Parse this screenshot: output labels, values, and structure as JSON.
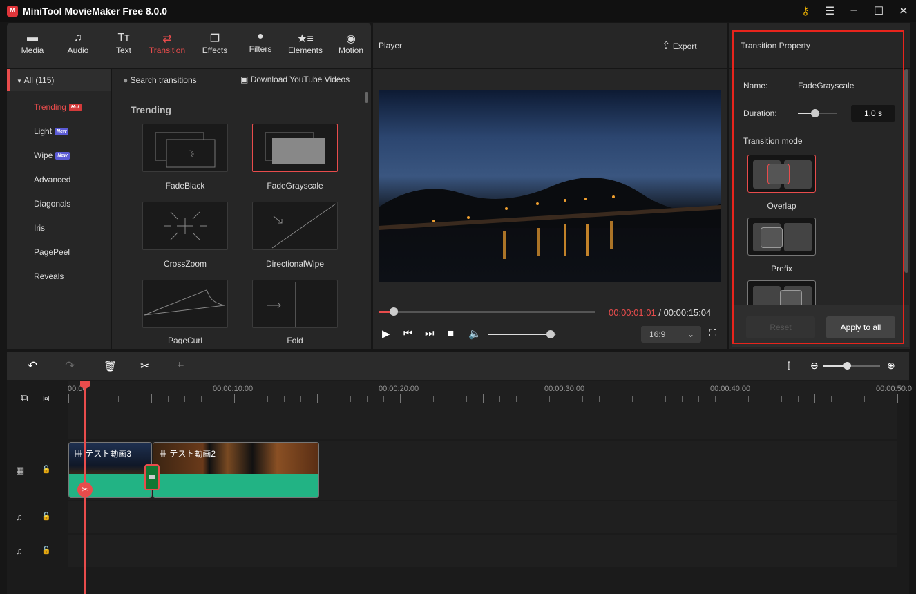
{
  "app": {
    "title": "MiniTool MovieMaker Free 8.0.0",
    "logo_text": "M"
  },
  "window_controls": {
    "key": "key-icon",
    "menu": "menu-icon",
    "minimize": "minimize-icon",
    "maximize": "maximize-icon",
    "close": "close-icon"
  },
  "toolbar": {
    "items": [
      {
        "label": "Media",
        "icon": "folder-icon"
      },
      {
        "label": "Audio",
        "icon": "music-icon"
      },
      {
        "label": "Text",
        "icon": "text-icon"
      },
      {
        "label": "Transition",
        "icon": "transition-icon",
        "active": true
      },
      {
        "label": "Effects",
        "icon": "effects-icon"
      },
      {
        "label": "Filters",
        "icon": "filters-icon"
      },
      {
        "label": "Elements",
        "icon": "elements-icon"
      },
      {
        "label": "Motion",
        "icon": "motion-icon"
      }
    ]
  },
  "categories": {
    "all": "All (115)",
    "items": [
      {
        "label": "Trending",
        "badge": "Hot",
        "active": true
      },
      {
        "label": "Light",
        "badge": "New"
      },
      {
        "label": "Wipe",
        "badge": "New"
      },
      {
        "label": "Advanced"
      },
      {
        "label": "Diagonals"
      },
      {
        "label": "Iris"
      },
      {
        "label": "PagePeel"
      },
      {
        "label": "Reveals"
      }
    ]
  },
  "library": {
    "search_placeholder": "Search transitions",
    "download": "Download YouTube Videos",
    "section": "Trending",
    "items": [
      "FadeBlack",
      "FadeGrayscale",
      "CrossZoom",
      "DirectionalWipe",
      "PageCurl",
      "Fold"
    ],
    "selected": "FadeGrayscale"
  },
  "player": {
    "title": "Player",
    "export": "Export",
    "current_time": "00:00:01:01",
    "separator": "/",
    "total_time": "00:00:15:04",
    "progress": 0.07,
    "volume": 0.92,
    "aspect": "16:9"
  },
  "property": {
    "title": "Transition Property",
    "name_label": "Name:",
    "name_value": "FadeGrayscale",
    "duration_label": "Duration:",
    "duration_value": "1.0 s",
    "duration_fraction": 0.45,
    "mode_label": "Transition mode",
    "modes": [
      "Overlap",
      "Prefix"
    ],
    "selected_mode": "Overlap",
    "reset": "Reset",
    "apply_all": "Apply to all"
  },
  "timeline": {
    "ruler": [
      "00:00",
      "00:00:10:00",
      "00:00:20:00",
      "00:00:30:00",
      "00:00:40:00",
      "00:00:50:0"
    ],
    "clips": [
      {
        "name": "テスト動画3"
      },
      {
        "name": "テスト動画2"
      }
    ]
  },
  "colors": {
    "accent": "#e84c4c",
    "audio": "#22b384"
  }
}
